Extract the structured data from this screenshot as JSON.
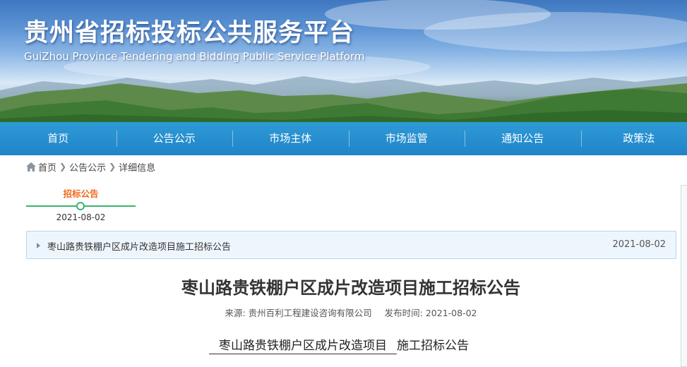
{
  "header": {
    "title": "贵州省招标投标公共服务平台",
    "subtitle": "GuiZhou Province Tendering and Bidding Public Service Platform"
  },
  "nav": {
    "items": [
      {
        "label": "首页"
      },
      {
        "label": "公告公示"
      },
      {
        "label": "市场主体"
      },
      {
        "label": "市场监管"
      },
      {
        "label": "通知公告"
      },
      {
        "label": "政策法"
      }
    ]
  },
  "breadcrumb": {
    "icon": "home-icon",
    "items": [
      "首页",
      "公告公示",
      "详细信息"
    ]
  },
  "timeline": {
    "label": "招标公告",
    "date": "2021-08-02",
    "color": "#3bb36a",
    "label_color": "#f06a1a"
  },
  "notice": {
    "title": "枣山路贵铁棚户区成片改造项目施工招标公告",
    "date": "2021-08-02"
  },
  "article": {
    "title": "枣山路贵铁棚户区成片改造项目施工招标公告",
    "source_label": "来源: 贵州百利工程建设咨询有限公司",
    "publish_label": "发布时间: 2021-08-02",
    "project_name": "枣山路贵铁棚户区成片改造项目",
    "body_suffix": "施工招标公告"
  },
  "colors": {
    "nav_bg": "#1f84c8",
    "accent": "#3bb36a"
  }
}
